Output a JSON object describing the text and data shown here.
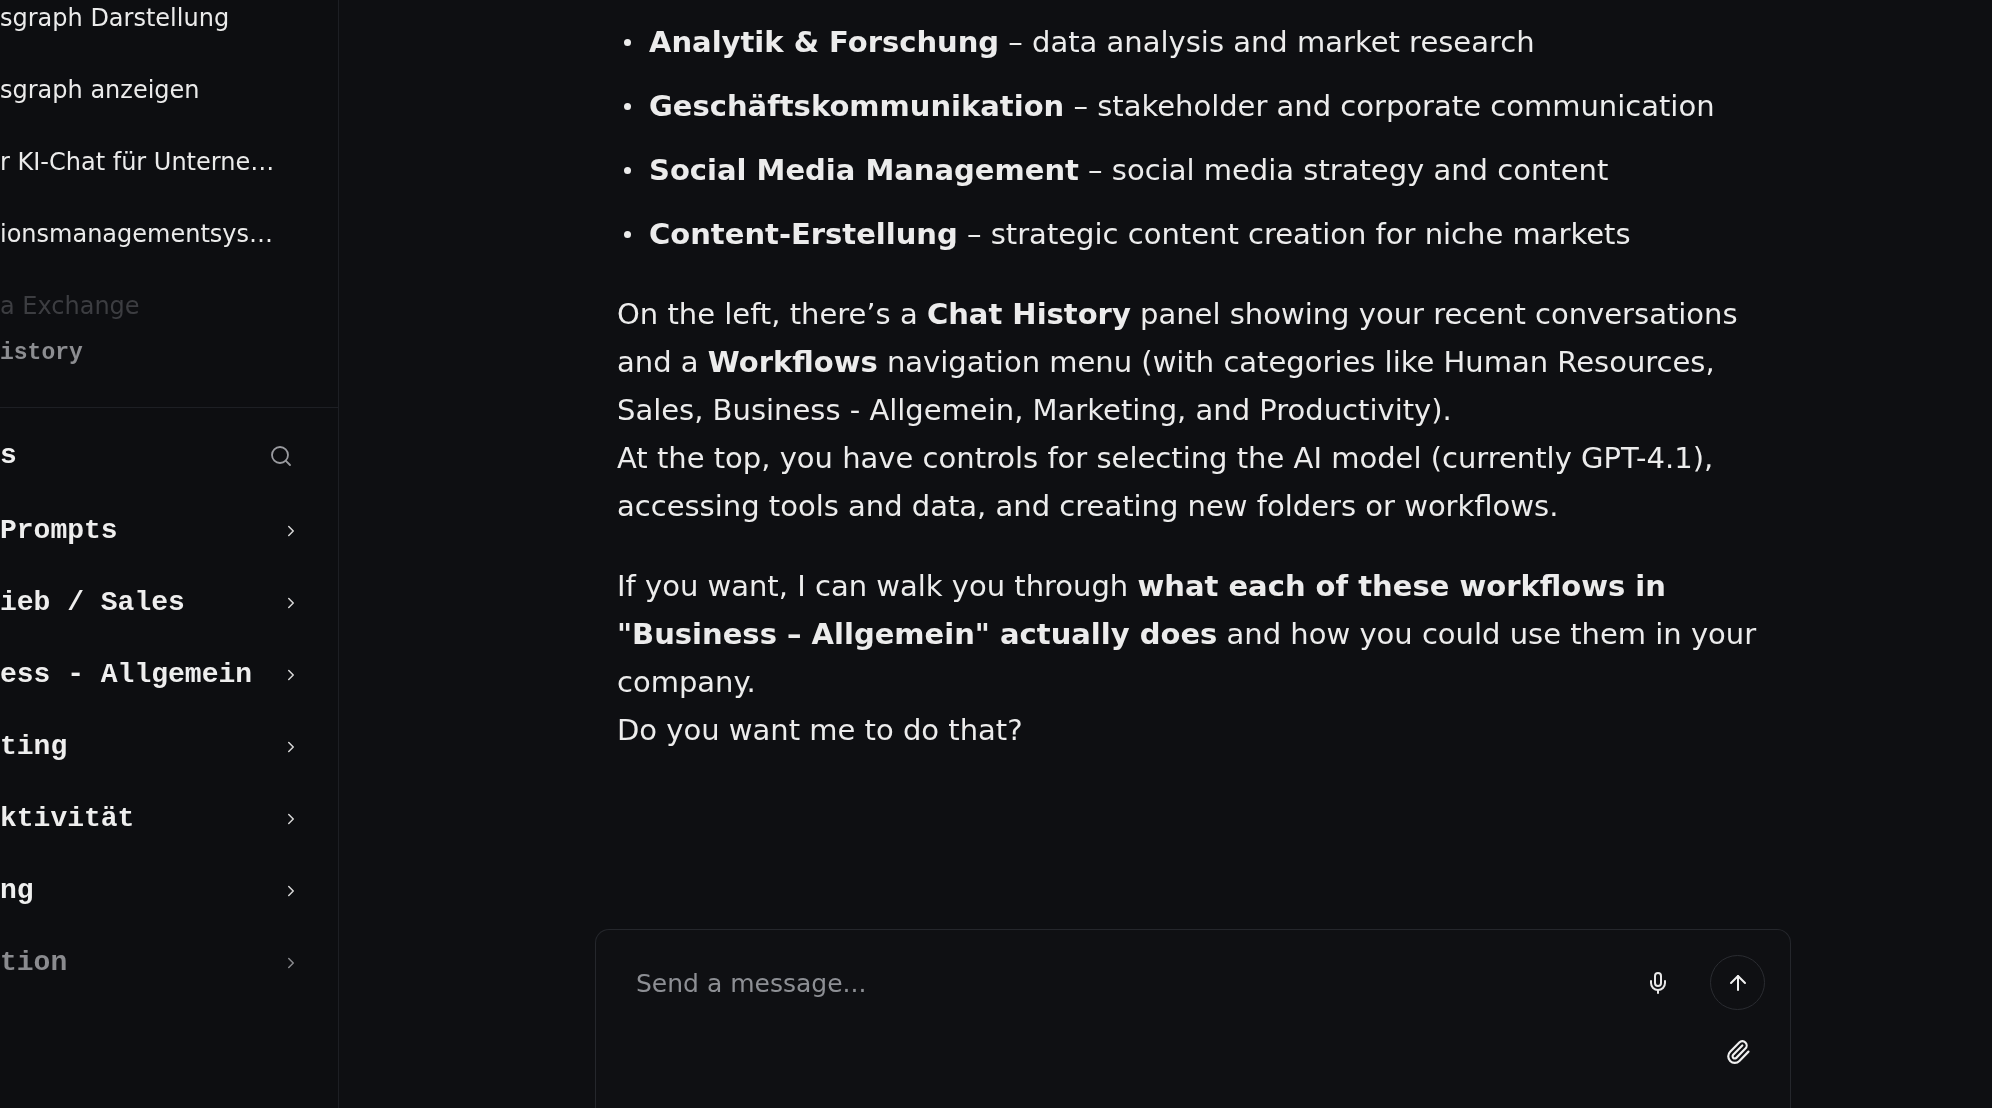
{
  "chat_history": {
    "items": [
      {
        "title": "sgraph Darstellung",
        "faded": false
      },
      {
        "title": "sgraph anzeigen",
        "faded": false
      },
      {
        "title": "r KI-Chat für Unterne…",
        "faded": false
      },
      {
        "title": "ionsmanagementsys…",
        "faded": false
      },
      {
        "title": "a Exchange",
        "faded": true
      }
    ],
    "section_label": "istory"
  },
  "workflows": {
    "heading": "s",
    "items": [
      {
        "label": "Prompts",
        "faded": false
      },
      {
        "label": "ieb / Sales",
        "faded": false
      },
      {
        "label": "ess - Allgemein",
        "faded": false
      },
      {
        "label": "ting",
        "faded": false
      },
      {
        "label": "ktivität",
        "faded": false
      },
      {
        "label": "ng",
        "faded": false
      },
      {
        "label": "tion",
        "faded": true
      }
    ]
  },
  "message": {
    "bullets": [
      "**Analytik & Forschung** – data analysis and market research",
      "**Geschäftskommunikation** – stakeholder and corporate communication",
      "**Social Media Management** – social media strategy and content",
      "**Content-Erstellung** – strategic content creation for niche markets"
    ],
    "paragraphs": [
      {
        "lines": [
          "On the left, there’s a **Chat History** panel showing your recent conversations and a **Workflows** navigation menu (with categories like Human Resources, Sales, Business - Allgemein, Marketing, and Productivity).",
          "At the top, you have controls for selecting the AI model (currently GPT-4.1), accessing tools and data, and creating new folders or workflows."
        ]
      },
      {
        "lines": [
          "If you want, I can walk you through **what each of these workflows in \"Business – Allgemein\" actually does** and how you could use them in your company.",
          "Do you want me to do that?"
        ]
      }
    ]
  },
  "composer": {
    "placeholder": "Send a message..."
  }
}
